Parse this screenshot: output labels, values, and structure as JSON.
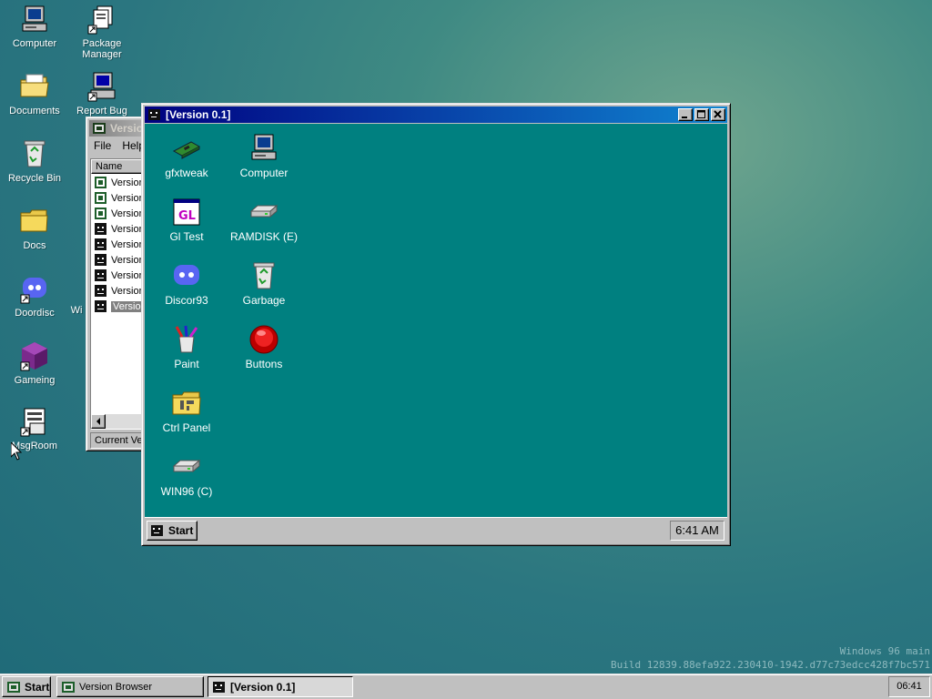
{
  "desktop": {
    "icons": [
      {
        "label": "Computer",
        "icon": "computer-icon"
      },
      {
        "label": "Package Manager",
        "icon": "package-manager-icon"
      },
      {
        "label": "Documents",
        "icon": "documents-folder-icon"
      },
      {
        "label": "Report Bug",
        "icon": "report-bug-icon"
      },
      {
        "label": "Recycle Bin",
        "icon": "recycle-bin-icon"
      },
      {
        "label": "Docs",
        "icon": "docs-folder-icon"
      },
      {
        "label": "Doordisc",
        "icon": "doordisc-icon"
      },
      {
        "label": "Gameing",
        "icon": "gameing-icon"
      },
      {
        "label": "MsgRoom",
        "icon": "msgroom-icon"
      },
      {
        "label": "Wi",
        "icon": "truncated-icon"
      }
    ],
    "watermark_line1": "Windows 96 main",
    "watermark_line2": "Build 12839.88efa922.230410-1942.d77c73edcc428f7bc571"
  },
  "version_browser": {
    "title": "Version",
    "menu": [
      "File",
      "Help"
    ],
    "column_header": "Name",
    "rows": [
      "Version",
      "Version",
      "Version",
      "Version",
      "Version",
      "Version",
      "Version",
      "Version",
      "Version"
    ],
    "selected_index": 8,
    "status": "Current Vers"
  },
  "main_window": {
    "title": "[Version 0.1]",
    "icons": [
      {
        "label": "gfxtweak",
        "icon": "gfxtweak-icon"
      },
      {
        "label": "Computer",
        "icon": "computer-icon"
      },
      {
        "label": "Gl Test",
        "icon": "gl-test-icon"
      },
      {
        "label": "RAMDISK (E)",
        "icon": "ramdisk-drive-icon"
      },
      {
        "label": "Discor93",
        "icon": "discor93-icon"
      },
      {
        "label": "Garbage",
        "icon": "garbage-icon"
      },
      {
        "label": "Paint",
        "icon": "paint-icon"
      },
      {
        "label": "Buttons",
        "icon": "buttons-icon"
      },
      {
        "label": "Ctrl Panel",
        "icon": "ctrl-panel-icon"
      },
      {
        "label": "WIN96 (C)",
        "icon": "win96-drive-icon"
      }
    ],
    "inner_start_label": "Start",
    "inner_clock": "6:41 AM"
  },
  "taskbar": {
    "start_label": "Start",
    "tasks": [
      {
        "label": "Version Browser",
        "active": false
      },
      {
        "label": "[Version 0.1]",
        "active": true
      }
    ],
    "clock": "06:41"
  },
  "colors": {
    "title_active_start": "#000080",
    "title_active_end": "#1084d0",
    "window_face": "#c0c0c0",
    "inner_desktop": "#008080",
    "selection": "#808080"
  }
}
